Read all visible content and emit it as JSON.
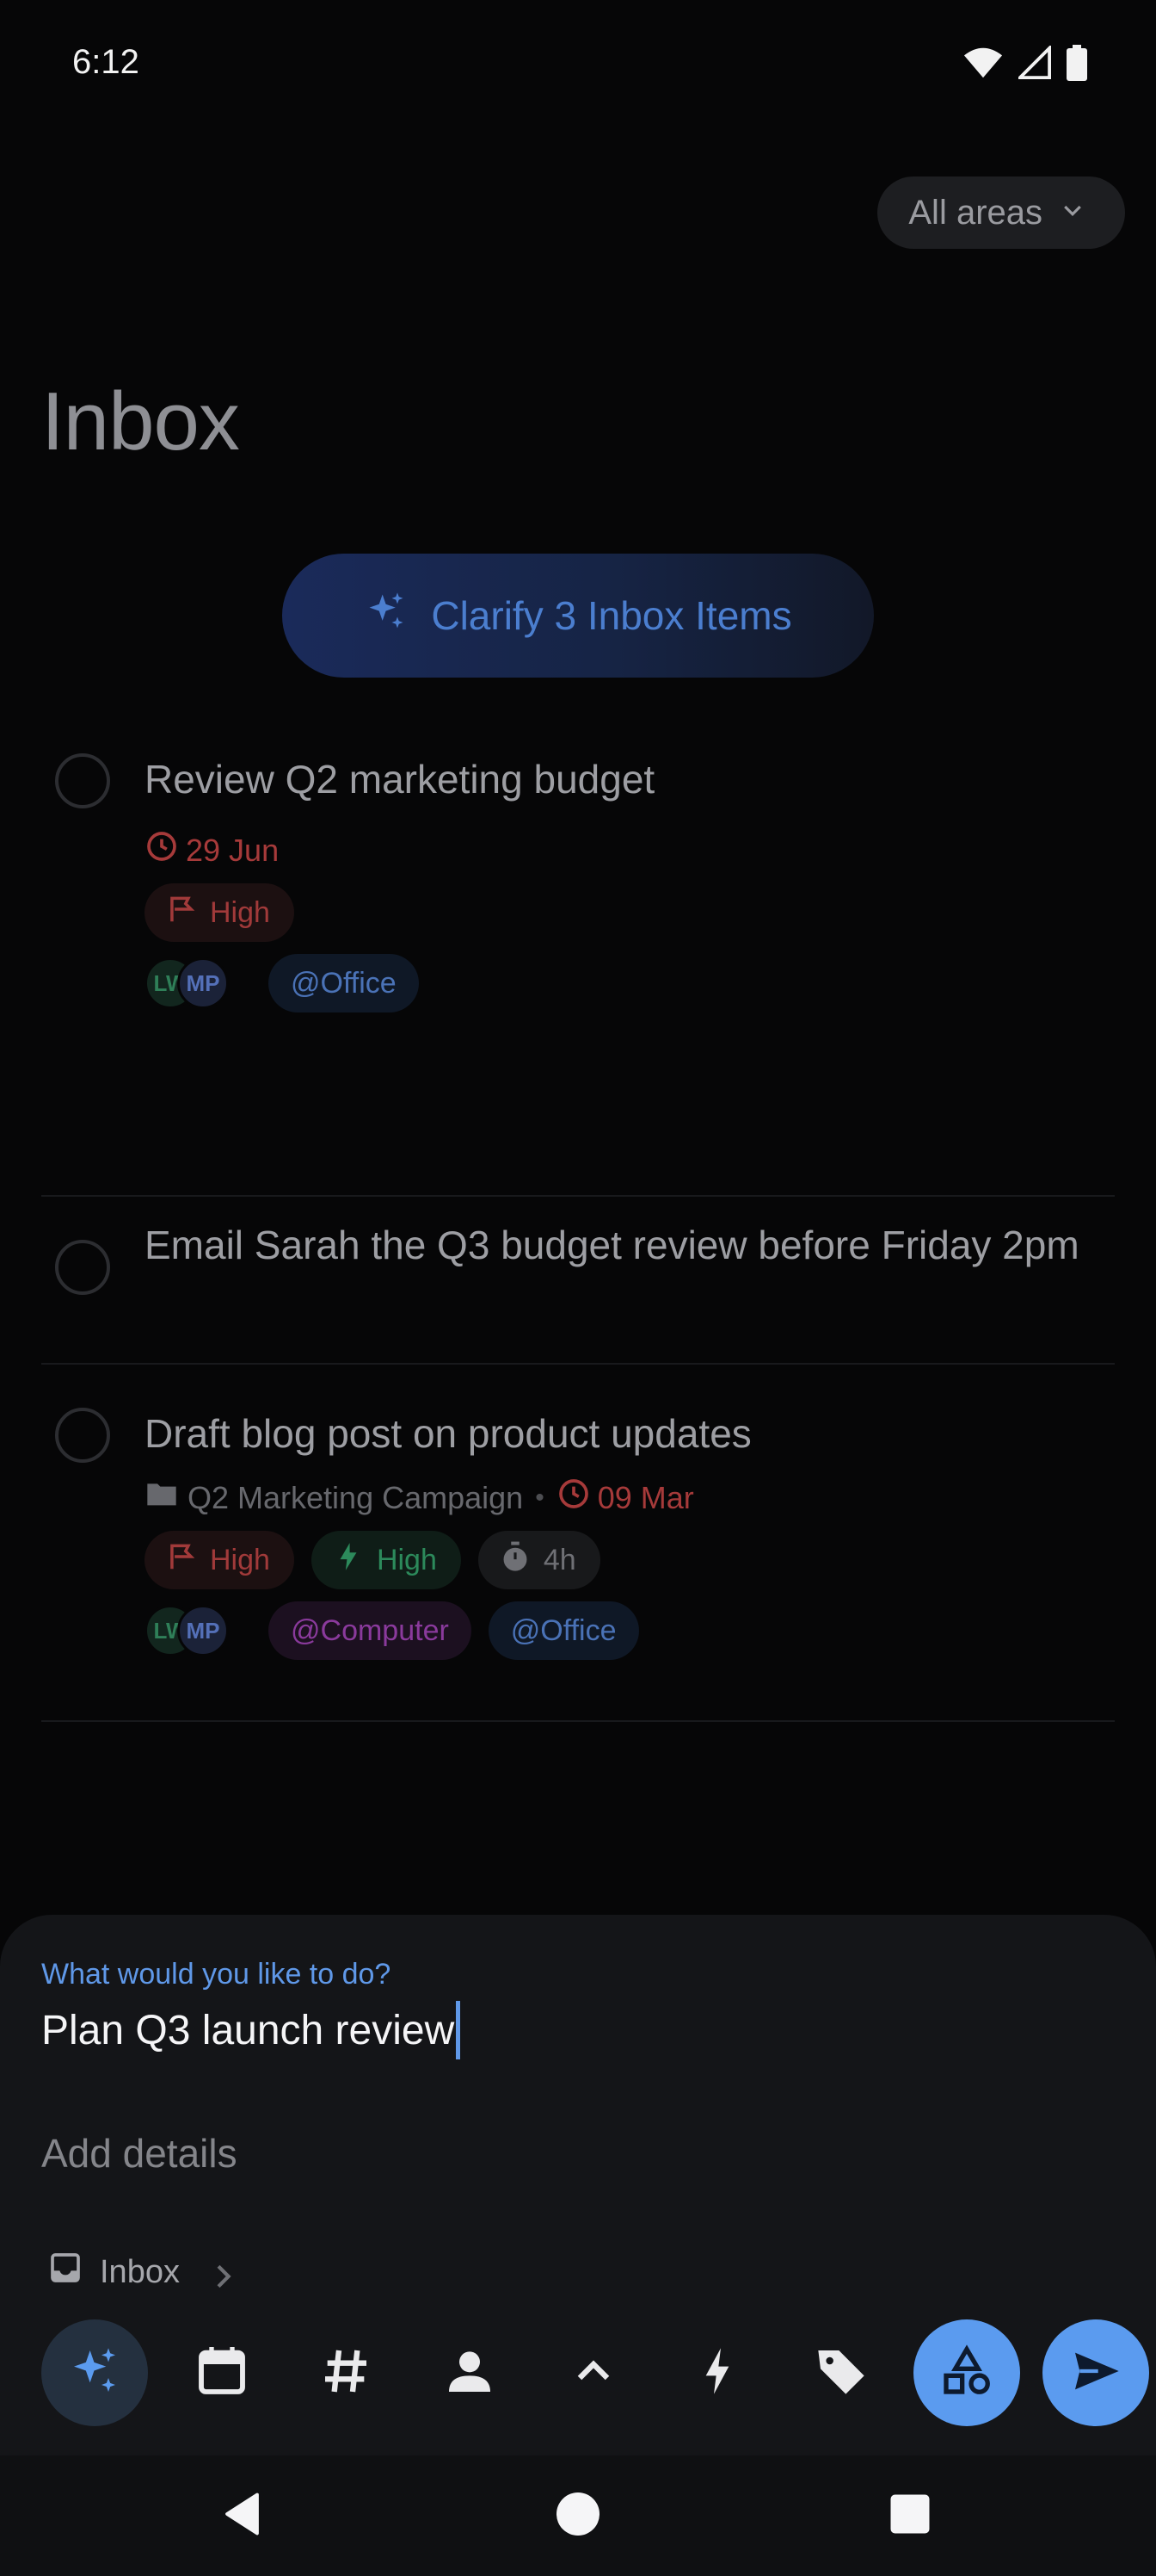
{
  "status_bar": {
    "time": "6:12"
  },
  "filter": {
    "label": "All areas"
  },
  "page": {
    "title": "Inbox"
  },
  "clarify": {
    "label": "Clarify 3 Inbox Items"
  },
  "tasks": [
    {
      "title": "Review Q2 marketing budget",
      "due": "29 Jun",
      "priority": "High",
      "people": [
        "LW",
        "MP"
      ],
      "contexts": [
        "@Office"
      ]
    },
    {
      "title": "Email Sarah the Q3 budget review before Friday 2pm"
    },
    {
      "title": "Draft blog post on product updates",
      "project": "Q2 Marketing Campaign",
      "separator": "•",
      "due": "09 Mar",
      "priority": "High",
      "energy": "High",
      "duration": "4h",
      "people": [
        "LW",
        "MP"
      ],
      "contexts": [
        "@Computer",
        "@Office"
      ]
    }
  ],
  "composer": {
    "prompt": "What would you like to do?",
    "input_value": "Plan Q3 launch review",
    "details_placeholder": "Add details",
    "location": "Inbox"
  },
  "colors": {
    "accent": "#5b9bef",
    "due_red": "#a63a3a",
    "energy_green": "#2c8a5b",
    "context_blue": "#4a72b6",
    "context_purple": "#8a3a9c"
  },
  "icons": {
    "toolbar": [
      "sparkles-icon",
      "calendar-icon",
      "hashtag-icon",
      "person-icon",
      "chevron-up-icon",
      "bolt-icon",
      "tag-icon",
      "shapes-icon",
      "send-icon"
    ],
    "nav": [
      "back-icon",
      "home-icon",
      "recents-icon"
    ]
  }
}
